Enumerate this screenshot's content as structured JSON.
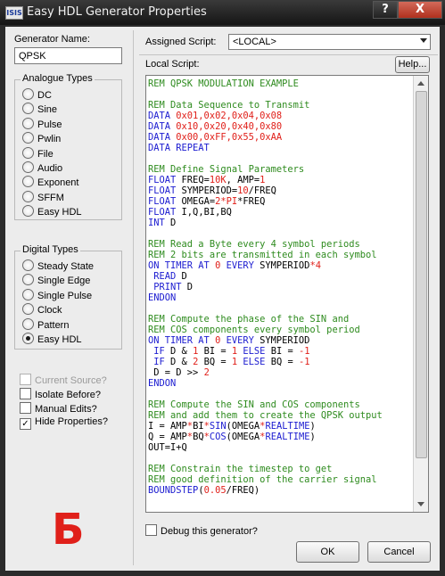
{
  "window": {
    "title": "Easy HDL Generator Properties",
    "icon_text": "ISIS",
    "help_glyph": "?",
    "close_glyph": "X"
  },
  "generator_name": {
    "label": "Generator Name:",
    "value": "QPSK"
  },
  "analogue": {
    "title": "Analogue Types",
    "items": [
      "DC",
      "Sine",
      "Pulse",
      "Pwlin",
      "File",
      "Audio",
      "Exponent",
      "SFFM",
      "Easy HDL"
    ]
  },
  "digital": {
    "title": "Digital Types",
    "items": [
      "Steady State",
      "Single Edge",
      "Single Pulse",
      "Clock",
      "Pattern",
      "Easy HDL"
    ],
    "selected": "Easy HDL"
  },
  "options": {
    "current_source": "Current Source?",
    "isolate_before": "Isolate Before?",
    "manual_edits": "Manual Edits?",
    "hide_properties": "Hide Properties?",
    "hide_properties_checked": true,
    "check_glyph": "✓"
  },
  "assigned_script": {
    "label": "Assigned Script:",
    "value": "<LOCAL>"
  },
  "local_script": {
    "label": "Local Script:",
    "help_button": "Help..."
  },
  "script_lines": [
    [
      [
        "REM QPSK MODULATION EXAMPLE",
        "com"
      ]
    ],
    [],
    [
      [
        "REM Data Sequence to Transmit",
        "com"
      ]
    ],
    [
      [
        "DATA ",
        "kw"
      ],
      [
        "0x01,0x02,0x04,0x08",
        "num"
      ]
    ],
    [
      [
        "DATA ",
        "kw"
      ],
      [
        "0x10,0x20,0x40,0x80",
        "num"
      ]
    ],
    [
      [
        "DATA ",
        "kw"
      ],
      [
        "0x00,0xFF,0x55,0xAA",
        "num"
      ]
    ],
    [
      [
        "DATA REPEAT",
        "kw"
      ]
    ],
    [],
    [
      [
        "REM Define Signal Parameters",
        "com"
      ]
    ],
    [
      [
        "FLOAT ",
        "kw"
      ],
      [
        "FREQ=",
        "plain"
      ],
      [
        "10K",
        "num"
      ],
      [
        ", AMP=",
        "plain"
      ],
      [
        "1",
        "num"
      ]
    ],
    [
      [
        "FLOAT ",
        "kw"
      ],
      [
        "SYMPERIOD=",
        "plain"
      ],
      [
        "10",
        "num"
      ],
      [
        "/FREQ",
        "plain"
      ]
    ],
    [
      [
        "FLOAT ",
        "kw"
      ],
      [
        "OMEGA=",
        "plain"
      ],
      [
        "2",
        "num"
      ],
      [
        "*",
        "num"
      ],
      [
        "PI",
        "num"
      ],
      [
        "*FREQ",
        "plain"
      ]
    ],
    [
      [
        "FLOAT ",
        "kw"
      ],
      [
        "I,Q,BI,BQ",
        "plain"
      ]
    ],
    [
      [
        "INT ",
        "kw"
      ],
      [
        "D",
        "plain"
      ]
    ],
    [],
    [
      [
        "REM Read a Byte every 4 symbol periods",
        "com"
      ]
    ],
    [
      [
        "REM 2 bits are transmitted in each symbol",
        "com"
      ]
    ],
    [
      [
        "ON TIMER AT ",
        "kw"
      ],
      [
        "0",
        "num"
      ],
      [
        " EVERY ",
        "kw"
      ],
      [
        "SYMPERIOD",
        "plain"
      ],
      [
        "*4",
        "num"
      ]
    ],
    [
      [
        " READ ",
        "kw"
      ],
      [
        "D",
        "plain"
      ]
    ],
    [
      [
        " PRINT ",
        "kw"
      ],
      [
        "D",
        "plain"
      ]
    ],
    [
      [
        "ENDON",
        "kw"
      ]
    ],
    [],
    [
      [
        "REM Compute the phase of the SIN and",
        "com"
      ]
    ],
    [
      [
        "REM COS components every symbol period",
        "com"
      ]
    ],
    [
      [
        "ON TIMER AT ",
        "kw"
      ],
      [
        "0",
        "num"
      ],
      [
        " EVERY ",
        "kw"
      ],
      [
        "SYMPERIOD",
        "plain"
      ]
    ],
    [
      [
        " IF ",
        "kw"
      ],
      [
        "D & ",
        "plain"
      ],
      [
        "1",
        "num"
      ],
      [
        " BI = ",
        "plain"
      ],
      [
        "1",
        "num"
      ],
      [
        " ELSE ",
        "kw"
      ],
      [
        "BI = ",
        "plain"
      ],
      [
        "-1",
        "num"
      ]
    ],
    [
      [
        " IF ",
        "kw"
      ],
      [
        "D & ",
        "plain"
      ],
      [
        "2",
        "num"
      ],
      [
        " BQ = ",
        "plain"
      ],
      [
        "1",
        "num"
      ],
      [
        " ELSE ",
        "kw"
      ],
      [
        "BQ = ",
        "plain"
      ],
      [
        "-1",
        "num"
      ]
    ],
    [
      [
        " D = D >> ",
        "plain"
      ],
      [
        "2",
        "num"
      ]
    ],
    [
      [
        "ENDON",
        "kw"
      ]
    ],
    [],
    [
      [
        "REM Compute the SIN and COS components",
        "com"
      ]
    ],
    [
      [
        "REM and add them to create the QPSK output",
        "com"
      ]
    ],
    [
      [
        "I = AMP",
        "plain"
      ],
      [
        "*",
        "num"
      ],
      [
        "BI",
        "plain"
      ],
      [
        "*",
        "num"
      ],
      [
        "SIN",
        "kw"
      ],
      [
        "(OMEGA",
        "plain"
      ],
      [
        "*",
        "num"
      ],
      [
        "REALTIME",
        "kw"
      ],
      [
        ")",
        "plain"
      ]
    ],
    [
      [
        "Q = AMP",
        "plain"
      ],
      [
        "*",
        "num"
      ],
      [
        "BQ",
        "plain"
      ],
      [
        "*",
        "num"
      ],
      [
        "COS",
        "kw"
      ],
      [
        "(OMEGA",
        "plain"
      ],
      [
        "*",
        "num"
      ],
      [
        "REALTIME",
        "kw"
      ],
      [
        ")",
        "plain"
      ]
    ],
    [
      [
        "OUT=I+Q",
        "plain"
      ]
    ],
    [],
    [
      [
        "REM Constrain the timestep to get",
        "com"
      ]
    ],
    [
      [
        "REM good definition of the carrier signal",
        "com"
      ]
    ],
    [
      [
        "BOUNDSTEP",
        "kw"
      ],
      [
        "(",
        "plain"
      ],
      [
        "0.05",
        "num"
      ],
      [
        "/FREQ)",
        "plain"
      ]
    ]
  ],
  "debug": {
    "label": "Debug this generator?"
  },
  "buttons": {
    "ok": "OK",
    "cancel": "Cancel"
  },
  "overlay_letter": "Б",
  "colors": {
    "comment": "#2e8b1e",
    "keyword": "#1b1bd0",
    "number": "#e0201a",
    "overlay": "#e0201a"
  }
}
